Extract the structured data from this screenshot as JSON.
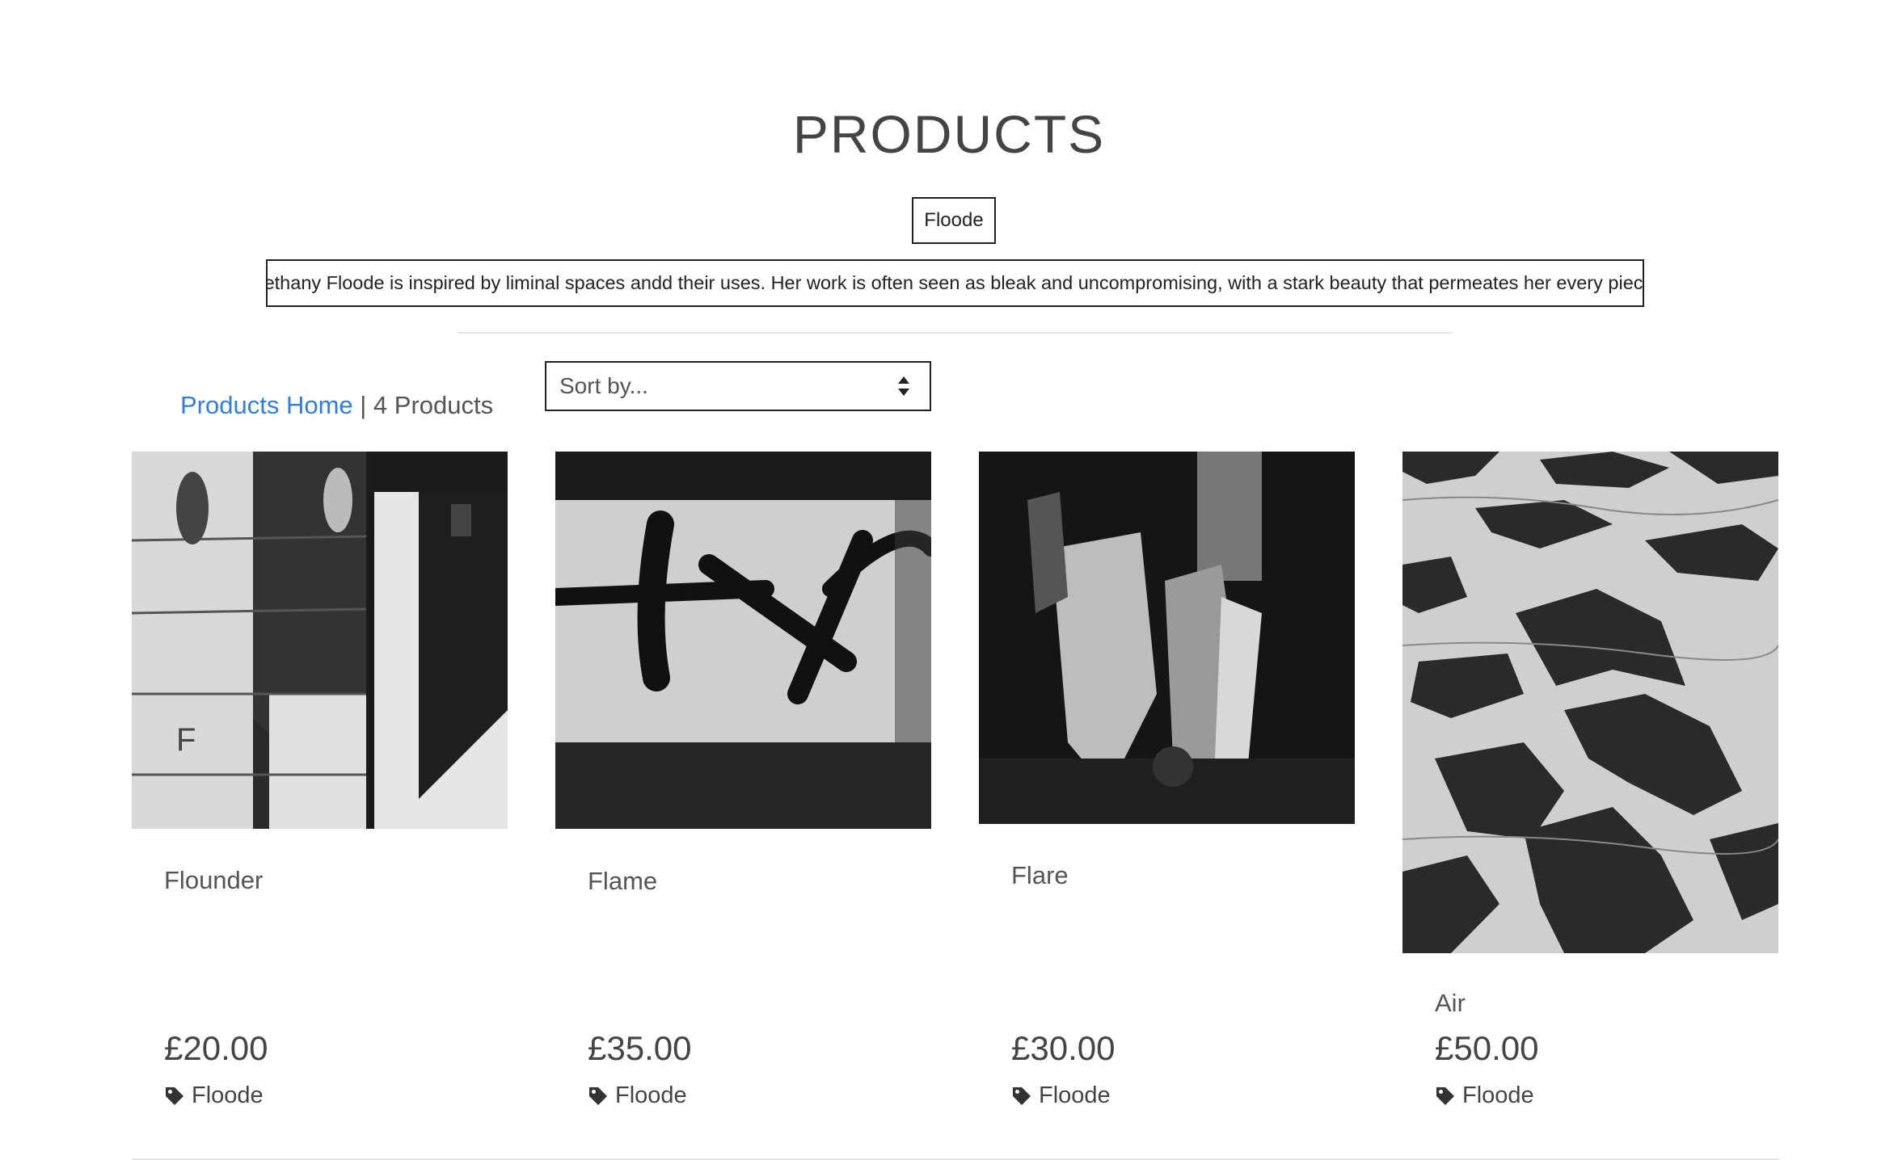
{
  "header": {
    "title": "PRODUCTS",
    "artist_button": "Floode",
    "artist_bio": "Bethany Floode is inspired by liminal spaces andd their uses. Her work is often seen as bleak and uncompromising, with a stark beauty that permeates her every piece."
  },
  "toolbar": {
    "products_home_link": "Products Home",
    "separator": " | ",
    "product_count": "4 Products",
    "sort_placeholder": "Sort by..."
  },
  "products": [
    {
      "name": "Flounder",
      "price": "£20.00",
      "artist": "Floode",
      "image": "flounder-photo"
    },
    {
      "name": "Flame",
      "price": "£35.00",
      "artist": "Floode",
      "image": "flame-photo"
    },
    {
      "name": "Flare",
      "price": "£30.00",
      "artist": "Floode",
      "image": "flare-photo"
    },
    {
      "name": "Air",
      "price": "£50.00",
      "artist": "Floode",
      "image": "air-photo"
    }
  ],
  "icons": {
    "tag": "tag-icon",
    "sort": "sort-arrows-icon"
  },
  "colors": {
    "link": "#2f7ee0",
    "text": "#444444",
    "border": "#222222"
  }
}
